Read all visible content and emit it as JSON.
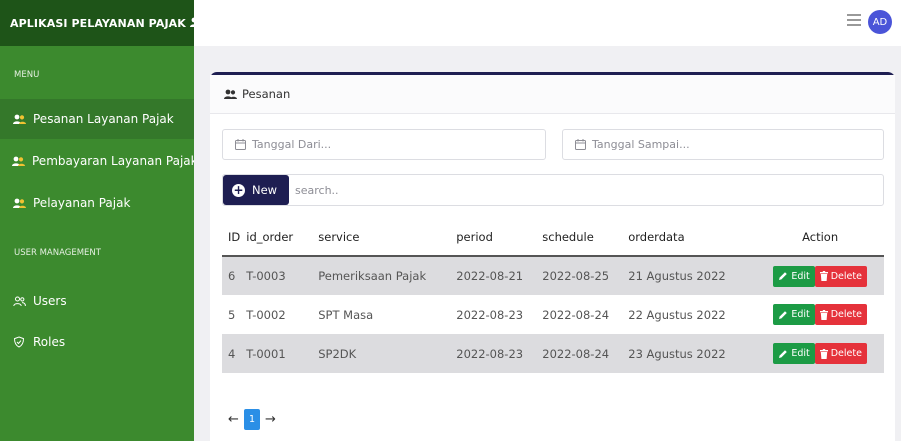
{
  "app": {
    "title": "APLIKASI PELAYANAN PAJAK",
    "user_initials": "AD"
  },
  "sidebar": {
    "menu_header": "MENU",
    "user_header": "USER MANAGEMENT",
    "items": [
      {
        "label": "Pesanan Layanan Pajak",
        "icon": "users-icon",
        "active": true
      },
      {
        "label": "Pembayaran Layanan Pajak",
        "icon": "users-icon"
      },
      {
        "label": "Pelayanan Pajak",
        "icon": "users-icon"
      },
      {
        "label": "Users",
        "icon": "user-group-icon"
      },
      {
        "label": "Roles",
        "icon": "shield-icon"
      }
    ]
  },
  "card": {
    "title": "Pesanan",
    "date_from_placeholder": "Tanggal Dari...",
    "date_to_placeholder": "Tanggal Sampai...",
    "new_label": "New",
    "search_placeholder": "search.."
  },
  "table": {
    "columns": [
      "ID",
      "id_order",
      "service",
      "period",
      "schedule",
      "orderdata",
      "Action"
    ],
    "rows": [
      {
        "id": "6",
        "id_order": "T-0003",
        "service": "Pemeriksaan Pajak",
        "period": "2022-08-21",
        "schedule": "2022-08-25",
        "orderdata": "21 Agustus 2022"
      },
      {
        "id": "5",
        "id_order": "T-0002",
        "service": "SPT Masa",
        "period": "2022-08-23",
        "schedule": "2022-08-24",
        "orderdata": "22 Agustus 2022"
      },
      {
        "id": "4",
        "id_order": "T-0001",
        "service": "SP2DK",
        "period": "2022-08-23",
        "schedule": "2022-08-24",
        "orderdata": "23 Agustus 2022"
      }
    ],
    "edit_label": "Edit",
    "delete_label": "Delete"
  },
  "pagination": {
    "prev": "←",
    "current_page": "1",
    "next": "→"
  },
  "colors": {
    "sidebar": "#3c8a2e",
    "brand_bar": "#1e5418",
    "primary_dark": "#1e1e52",
    "edit": "#1c9b45",
    "delete": "#e5323b",
    "page_active": "#2b8fe6",
    "avatar": "#4a54d8"
  }
}
